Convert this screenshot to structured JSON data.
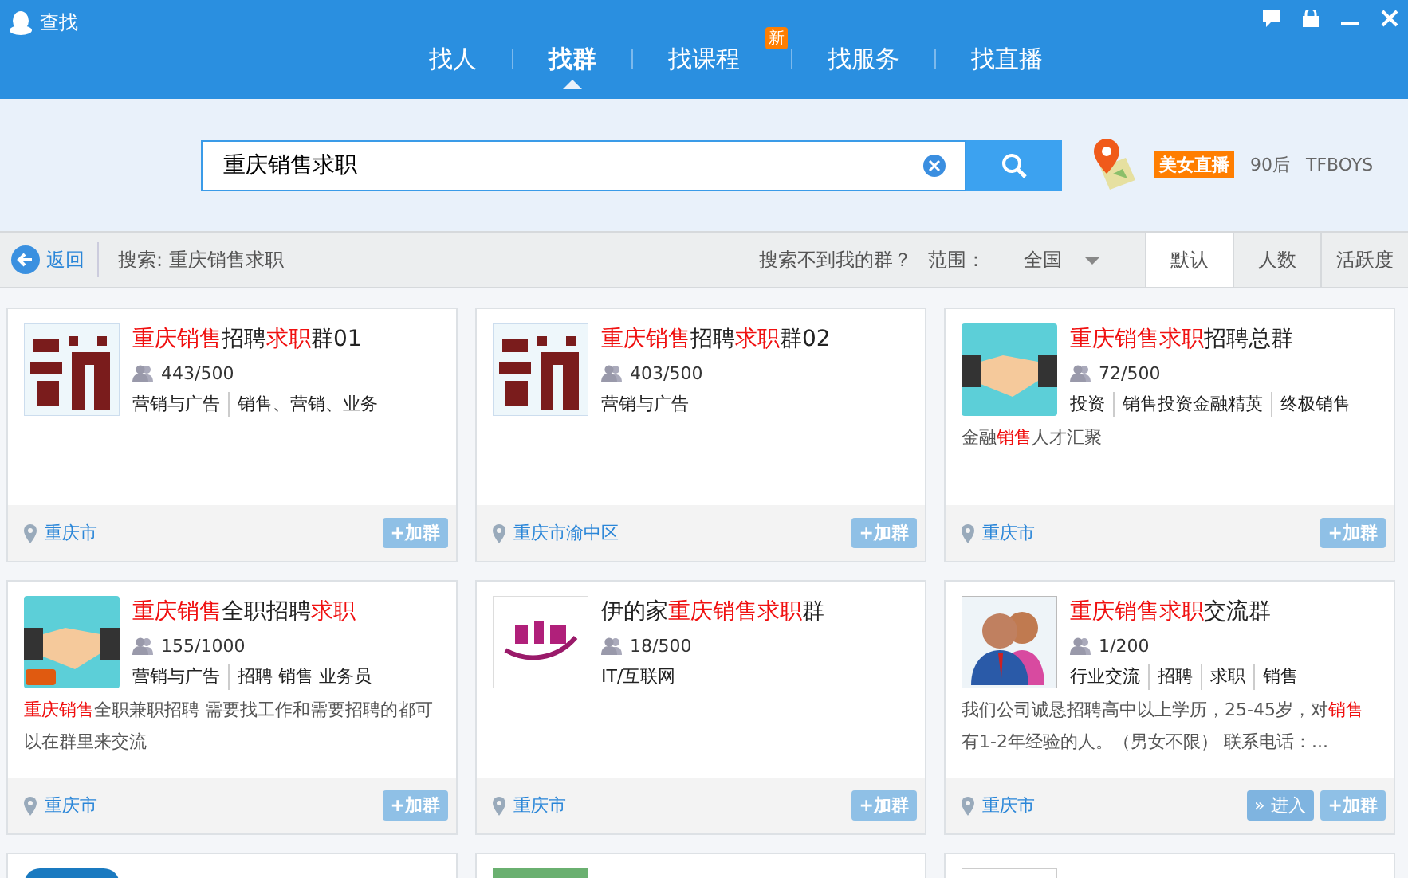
{
  "window": {
    "title": "查找"
  },
  "tabs": [
    {
      "label": "找人",
      "selected": false
    },
    {
      "label": "找群",
      "selected": true
    },
    {
      "label": "找课程",
      "selected": false,
      "badge": "新"
    },
    {
      "label": "找服务",
      "selected": false
    },
    {
      "label": "找直播",
      "selected": false
    }
  ],
  "search": {
    "value": "重庆销售求职"
  },
  "hot_tags": [
    {
      "label": "美女直播",
      "kind": "tag"
    },
    {
      "label": "90后",
      "kind": "link"
    },
    {
      "label": "TFBOYS",
      "kind": "link"
    }
  ],
  "toolbar": {
    "back": "返回",
    "query": "搜索: 重庆销售求职",
    "help": "搜索不到我的群？",
    "range_label": "范围：",
    "range_value": "全国",
    "sorts": [
      {
        "label": "默认",
        "selected": true
      },
      {
        "label": "人数",
        "selected": false
      },
      {
        "label": "活跃度",
        "selected": false
      }
    ]
  },
  "groups": [
    {
      "avatar": {
        "kind": "char-image"
      },
      "title": [
        {
          "text": "重庆销售",
          "highlight": true
        },
        {
          "text": "招聘",
          "highlight": false
        },
        {
          "text": "求职",
          "highlight": true
        },
        {
          "text": "群01",
          "highlight": false
        }
      ],
      "members": "443/500",
      "tags": [
        "营销与广告",
        "销售、营销、业务"
      ],
      "location": "重庆市",
      "buttons": [
        {
          "kind": "join",
          "label": "+加群"
        }
      ]
    },
    {
      "avatar": {
        "kind": "char-image"
      },
      "title": [
        {
          "text": "重庆销售",
          "highlight": true
        },
        {
          "text": "招聘",
          "highlight": false
        },
        {
          "text": "求职",
          "highlight": true
        },
        {
          "text": "群02",
          "highlight": false
        }
      ],
      "members": "403/500",
      "tags": [
        "营销与广告"
      ],
      "location": "重庆市渝中区",
      "buttons": [
        {
          "kind": "join",
          "label": "+加群"
        }
      ]
    },
    {
      "avatar": {
        "kind": "handshake"
      },
      "title": [
        {
          "text": "重庆销售求职",
          "highlight": true
        },
        {
          "text": "招聘总群",
          "highlight": false
        }
      ],
      "members": "72/500",
      "tags": [
        "投资",
        "销售投资金融精英",
        "终极销售"
      ],
      "description": [
        {
          "text": "金融",
          "highlight": false
        },
        {
          "text": "销售",
          "highlight": true
        },
        {
          "text": "人才汇聚",
          "highlight": false
        }
      ],
      "location": "重庆市",
      "buttons": [
        {
          "kind": "join",
          "label": "+加群"
        }
      ]
    },
    {
      "avatar": {
        "kind": "handshake-badge"
      },
      "title": [
        {
          "text": "重庆销售",
          "highlight": true
        },
        {
          "text": "全职招聘",
          "highlight": false
        },
        {
          "text": "求职",
          "highlight": true
        }
      ],
      "members": "155/1000",
      "tags": [
        "营销与广告",
        "招聘 销售 业务员"
      ],
      "description": [
        {
          "text": "重庆销售",
          "highlight": true
        },
        {
          "text": "全职兼职招聘 需要找工作和需要招聘的都可以在群里来交流",
          "highlight": false
        }
      ],
      "location": "重庆市",
      "buttons": [
        {
          "kind": "join",
          "label": "+加群"
        }
      ]
    },
    {
      "avatar": {
        "kind": "logo"
      },
      "title": [
        {
          "text": "伊的家",
          "highlight": false
        },
        {
          "text": "重庆销售求职",
          "highlight": true
        },
        {
          "text": "群",
          "highlight": false
        }
      ],
      "members": "18/500",
      "tags": [
        "IT/互联网"
      ],
      "location": "重庆市",
      "buttons": [
        {
          "kind": "join",
          "label": "+加群"
        }
      ]
    },
    {
      "avatar": {
        "kind": "people"
      },
      "title": [
        {
          "text": "重庆销售求职",
          "highlight": true
        },
        {
          "text": "交流群",
          "highlight": false
        }
      ],
      "members": "1/200",
      "tags": [
        "行业交流",
        "招聘",
        "求职",
        "销售"
      ],
      "description": [
        {
          "text": "我们公司诚恳招聘高中以上学历，25-45岁，对",
          "highlight": false
        },
        {
          "text": "销售",
          "highlight": true
        },
        {
          "text": "有1-2年经验的人。（男女不限） 联系电话：...",
          "highlight": false
        }
      ],
      "location": "重庆市",
      "buttons": [
        {
          "kind": "enter",
          "label": "» 进入"
        },
        {
          "kind": "join",
          "label": "+加群"
        }
      ]
    },
    {
      "avatar": {
        "kind": "blue-block"
      }
    },
    {
      "avatar": {
        "kind": "green-block"
      }
    },
    {
      "avatar": {
        "kind": "plain-block"
      }
    }
  ]
}
